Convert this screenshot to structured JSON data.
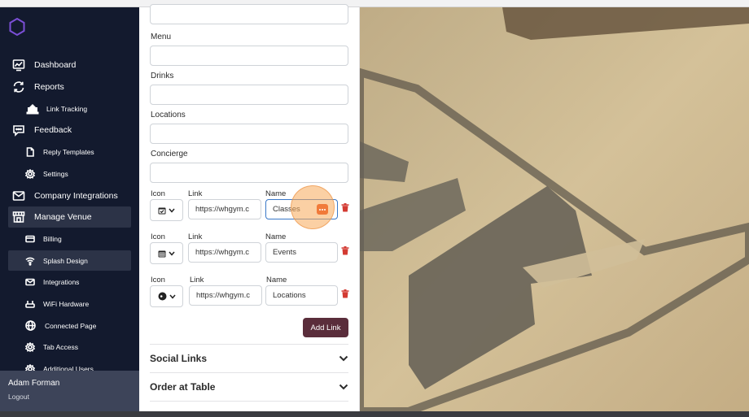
{
  "sidebar": {
    "items": [
      {
        "label": "Dashboard",
        "icon": "chart-icon",
        "level": "main"
      },
      {
        "label": "Reports",
        "icon": "refresh-icon",
        "level": "main"
      },
      {
        "label": "Link Tracking",
        "icon": "link-tracking-icon",
        "level": "sub"
      },
      {
        "label": "Feedback",
        "icon": "chat-icon",
        "level": "main"
      },
      {
        "label": "Reply Templates",
        "icon": "document-icon",
        "level": "sub"
      },
      {
        "label": "Settings",
        "icon": "gear-icon",
        "level": "sub"
      },
      {
        "label": "Company Integrations",
        "icon": "mail-icon",
        "level": "main"
      },
      {
        "label": "Manage Venue",
        "icon": "store-icon",
        "level": "main",
        "active": true
      },
      {
        "label": "Billing",
        "icon": "card-icon",
        "level": "sub"
      },
      {
        "label": "Splash Design",
        "icon": "wifi-icon",
        "level": "sub",
        "active": true
      },
      {
        "label": "Integrations",
        "icon": "envelope-icon",
        "level": "sub"
      },
      {
        "label": "WiFi Hardware",
        "icon": "router-icon",
        "level": "sub"
      },
      {
        "label": "Connected Page",
        "icon": "globe-icon",
        "level": "sub"
      },
      {
        "label": "Tab Access",
        "icon": "gear-icon",
        "level": "sub"
      },
      {
        "label": "Additional Users",
        "icon": "gear-icon",
        "level": "sub"
      }
    ],
    "user": {
      "name": "Adam Forman",
      "logout": "Logout"
    }
  },
  "form": {
    "fields": [
      {
        "label": "Menu",
        "value": ""
      },
      {
        "label": "Drinks",
        "value": ""
      },
      {
        "label": "Locations",
        "value": ""
      },
      {
        "label": "Concierge",
        "value": ""
      }
    ],
    "links": [
      {
        "icon_label": "Icon",
        "link_label": "Link",
        "name_label": "Name",
        "icon": "calendar-check-icon",
        "link": "https://whgym.c",
        "name": "Classes"
      },
      {
        "icon_label": "Icon",
        "link_label": "Link",
        "name_label": "Name",
        "icon": "calendar-grid-icon",
        "link": "https://whgym.c",
        "name": "Events"
      },
      {
        "icon_label": "Icon",
        "link_label": "Link",
        "name_label": "Name",
        "icon": "location-dot-icon",
        "link": "https://whgym.c",
        "name": "Locations"
      }
    ],
    "add_link_label": "Add Link",
    "sections": [
      "Social Links",
      "Order at Table"
    ]
  },
  "colors": {
    "sidebar_bg": "#131a2e",
    "sidebar_active": "#2c3347",
    "accent_button": "#5a2d3b",
    "delete_red": "#d33a32",
    "logo_purple": "#7b4fd6"
  }
}
